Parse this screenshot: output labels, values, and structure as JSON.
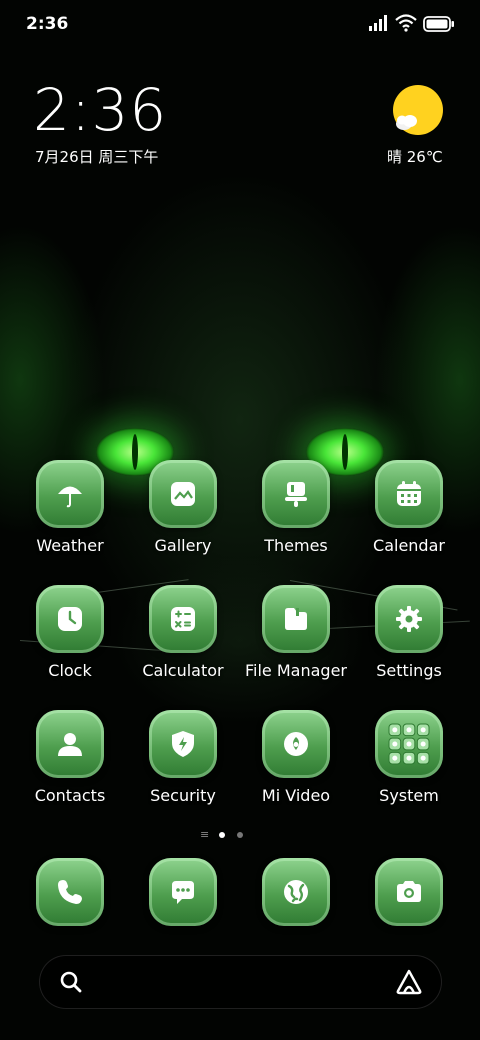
{
  "status_bar": {
    "time": "2:36",
    "icons": [
      "signal-icon",
      "wifi-icon",
      "battery-icon"
    ]
  },
  "clock_widget": {
    "time": "2:36",
    "date": "7月26日 周三下午"
  },
  "weather_widget": {
    "condition_temp": "晴 26℃",
    "icon": "sunny-icon"
  },
  "apps": [
    {
      "label": "Weather",
      "icon": "umbrella-icon"
    },
    {
      "label": "Gallery",
      "icon": "image-icon"
    },
    {
      "label": "Themes",
      "icon": "brush-icon"
    },
    {
      "label": "Calendar",
      "icon": "calendar-icon"
    },
    {
      "label": "Clock",
      "icon": "clock-icon"
    },
    {
      "label": "Calculator",
      "icon": "calculator-icon"
    },
    {
      "label": "File Manager",
      "icon": "folder-icon"
    },
    {
      "label": "Settings",
      "icon": "gear-icon"
    },
    {
      "label": "Contacts",
      "icon": "person-icon"
    },
    {
      "label": "Security",
      "icon": "shield-icon"
    },
    {
      "label": "Mi Video",
      "icon": "play-icon"
    },
    {
      "label": "System",
      "icon": "folder-grid-icon"
    }
  ],
  "page_indicator": {
    "pages": 2,
    "current": 1
  },
  "dock": [
    {
      "icon": "phone-icon"
    },
    {
      "icon": "message-icon"
    },
    {
      "icon": "browser-icon"
    },
    {
      "icon": "camera-icon"
    }
  ],
  "search_bar": {
    "icons": [
      "search-icon",
      "assistant-icon"
    ]
  },
  "colors": {
    "icon_top": "#8fd48f",
    "icon_bottom": "#2f7a32",
    "glow": "#49e638"
  }
}
